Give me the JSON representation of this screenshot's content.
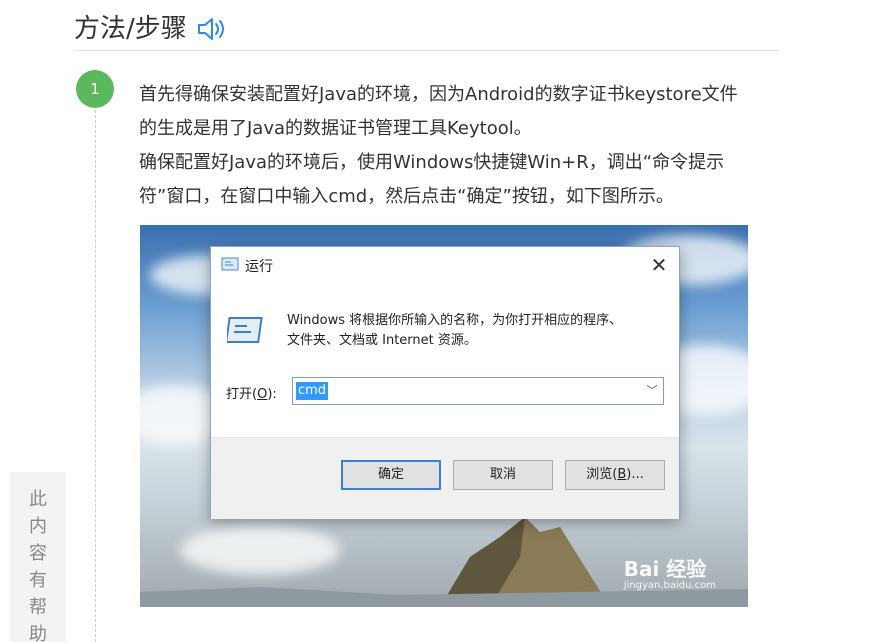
{
  "section": {
    "title": "方法/步骤",
    "audio_icon": "speaker-icon"
  },
  "step": {
    "number": "1",
    "lines": [
      "首先得确保安装配置好Java的环境，因为Android的数字证书keystore文件",
      "的生成是用了Java的数据证书管理工具Keytool。",
      "确保配置好Java的环境后，使用Windows快捷键Win+R，调出“命令提示",
      "符”窗口，在窗口中输入cmd，然后点击“确定”按钮，如下图所示。"
    ]
  },
  "run_dialog": {
    "title": "运行",
    "close_icon": "close-icon",
    "description_line1": "Windows 将根据你所输入的名称，为你打开相应的程序、",
    "description_line2": "文件夹、文档或 Internet 资源。",
    "open_label_prefix": "打开(",
    "open_label_key": "O",
    "open_label_suffix": "):",
    "open_value": "cmd",
    "ok_label": "确定",
    "cancel_label": "取消",
    "browse_label_prefix": "浏览(",
    "browse_label_key": "B",
    "browse_label_suffix": ")..."
  },
  "watermark": {
    "logo": "Bai 经验",
    "url": "jingyan.baidu.com"
  },
  "side_tab": {
    "chars": [
      "此",
      "内",
      "容",
      "有",
      "帮",
      "助"
    ]
  },
  "colors": {
    "step_badge": "#5cb85c",
    "accent_blue": "#2e8ae6",
    "selection": "#3399ff"
  }
}
